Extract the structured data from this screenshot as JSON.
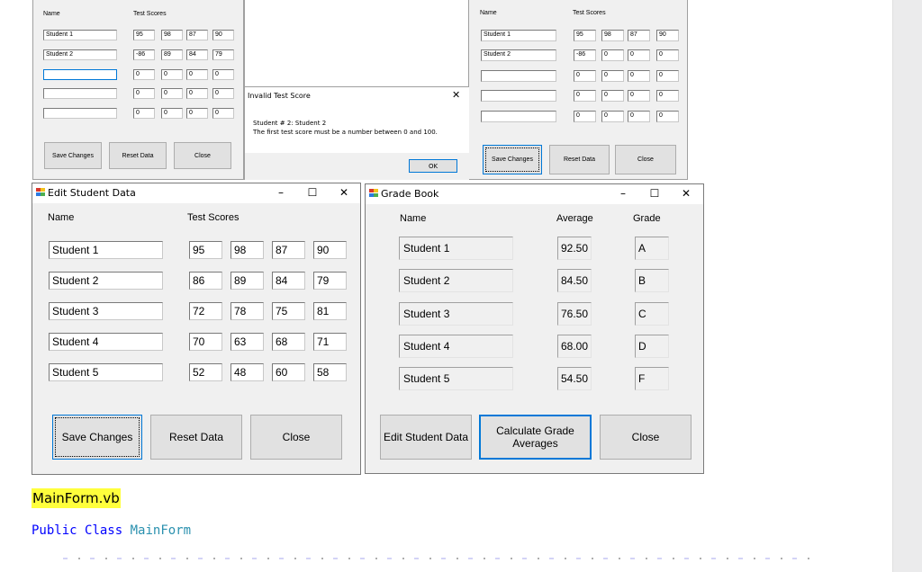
{
  "snapshot_left": {
    "labels": {
      "name": "Name",
      "test_scores": "Test Scores"
    },
    "rows": [
      {
        "name": "Student 1",
        "scores": [
          "95",
          "98",
          "87",
          "90"
        ]
      },
      {
        "name": "Student 2",
        "scores": [
          "-86",
          "89",
          "84",
          "79"
        ]
      },
      {
        "name": "",
        "scores": [
          "0",
          "0",
          "0",
          "0"
        ]
      },
      {
        "name": "",
        "scores": [
          "0",
          "0",
          "0",
          "0"
        ]
      },
      {
        "name": "",
        "scores": [
          "0",
          "0",
          "0",
          "0"
        ]
      }
    ],
    "buttons": {
      "save": "Save Changes",
      "reset": "Reset Data",
      "close": "Close"
    }
  },
  "dialog": {
    "title": "Invalid Test Score",
    "close_icon": "close-icon",
    "message_line1": "Student # 2: Student 2",
    "message_line2": "The first test score must be a number between 0 and 100.",
    "ok": "OK"
  },
  "snapshot_right": {
    "labels": {
      "name": "Name",
      "test_scores": "Test Scores"
    },
    "rows": [
      {
        "name": "Student 1",
        "scores": [
          "95",
          "98",
          "87",
          "90"
        ]
      },
      {
        "name": "Student 2",
        "scores": [
          "-86",
          "0",
          "0",
          "0"
        ]
      },
      {
        "name": "",
        "scores": [
          "0",
          "0",
          "0",
          "0"
        ]
      },
      {
        "name": "",
        "scores": [
          "0",
          "0",
          "0",
          "0"
        ]
      },
      {
        "name": "",
        "scores": [
          "0",
          "0",
          "0",
          "0"
        ]
      }
    ],
    "buttons": {
      "save": "Save Changes",
      "reset": "Reset Data",
      "close": "Close"
    }
  },
  "edit_form": {
    "title": "Edit Student Data",
    "labels": {
      "name": "Name",
      "test_scores": "Test Scores"
    },
    "rows": [
      {
        "name": "Student 1",
        "scores": [
          "95",
          "98",
          "87",
          "90"
        ]
      },
      {
        "name": "Student 2",
        "scores": [
          "86",
          "89",
          "84",
          "79"
        ]
      },
      {
        "name": "Student 3",
        "scores": [
          "72",
          "78",
          "75",
          "81"
        ]
      },
      {
        "name": "Student 4",
        "scores": [
          "70",
          "63",
          "68",
          "71"
        ]
      },
      {
        "name": "Student 5",
        "scores": [
          "52",
          "48",
          "60",
          "58"
        ]
      }
    ],
    "buttons": {
      "save": "Save Changes",
      "reset": "Reset Data",
      "close": "Close"
    },
    "controls": {
      "minimize": "–",
      "maximize": "☐",
      "close": "✕"
    }
  },
  "grade_book": {
    "title": "Grade Book",
    "labels": {
      "name": "Name",
      "average": "Average",
      "grade": "Grade"
    },
    "rows": [
      {
        "name": "Student 1",
        "average": "92.50",
        "grade": "A"
      },
      {
        "name": "Student 2",
        "average": "84.50",
        "grade": "B"
      },
      {
        "name": "Student 3",
        "average": "76.50",
        "grade": "C"
      },
      {
        "name": "Student 4",
        "average": "68.00",
        "grade": "D"
      },
      {
        "name": "Student 5",
        "average": "54.50",
        "grade": "F"
      }
    ],
    "buttons": {
      "edit": "Edit Student Data",
      "calc_line1": "Calculate Grade",
      "calc_line2": "Averages",
      "close": "Close"
    },
    "controls": {
      "minimize": "–",
      "maximize": "☐",
      "close": "✕"
    }
  },
  "document": {
    "file_heading": "MainForm.vb",
    "code": {
      "kw1": "Public",
      "kw2": "Class",
      "class_name": "MainForm"
    }
  },
  "colors": {
    "accent": "#0078d7",
    "form_bg": "#f0f0f0",
    "highlight": "#ffff3c",
    "keyword": "#0000ff",
    "type_name": "#2b91af"
  }
}
